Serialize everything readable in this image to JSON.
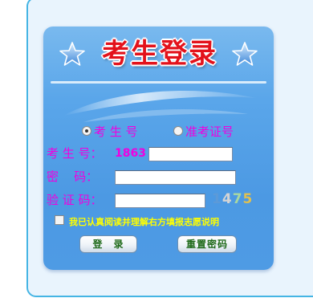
{
  "login": {
    "title": "考生登录",
    "radio_options": [
      {
        "label": "考 生 号",
        "checked": true
      },
      {
        "label": "准考证号",
        "checked": false
      }
    ],
    "fields": {
      "candidate_label": "考 生 号：",
      "candidate_prefix": "1863",
      "candidate_value": "",
      "password_label": "密    码：",
      "password_value": "",
      "captcha_label": "验 证 码：",
      "captcha_value": ""
    },
    "captcha": {
      "digits": [
        "1",
        "4",
        "7",
        "5"
      ],
      "colors": [
        "#5c9ad8",
        "#d4d4d4",
        "#a9d8a0",
        "#e0c050"
      ]
    },
    "agree_text": "我已认真阅读并理解右方填报志愿说明",
    "agree_checked": false,
    "buttons": {
      "login": "登　录",
      "reset": "重置密码"
    }
  },
  "colors": {
    "label": "#f000e0",
    "agree": "#ffff00",
    "title": "#e3121b",
    "panel_border": "#45b5e4",
    "panel_bg": "#e9f4fd",
    "box_blue": "#4e9be4"
  },
  "icons": [
    "star-icon-left",
    "star-icon-right"
  ]
}
